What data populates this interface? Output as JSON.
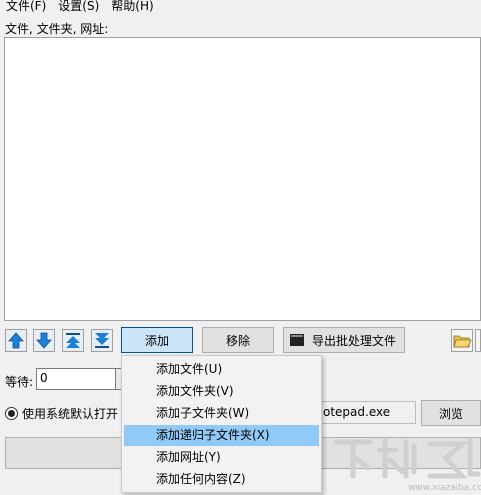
{
  "menubar": {
    "items": [
      "文件(F)",
      "设置(S)",
      "帮助(H)"
    ]
  },
  "list_label": "文件, 文件夹, 网址:",
  "toolbar": {
    "move_up_icon": "arrow-up",
    "move_down_icon": "arrow-down",
    "move_top_icon": "arrow-to-top",
    "move_bottom_icon": "arrow-to-bottom",
    "add_label": "添加",
    "remove_label": "移除",
    "export_label": "导出批处理文件",
    "open_folder_icon": "folder-open"
  },
  "wait": {
    "label": "等待:",
    "value": "0"
  },
  "open_with": {
    "label": "使用系统默认打开",
    "path_value": "otepad.exe",
    "browse_label": "浏览"
  },
  "add_menu": {
    "items": [
      "添加文件(U)",
      "添加文件夹(V)",
      "添加子文件夹(W)",
      "添加递归子文件夹(X)",
      "添加网址(Y)",
      "添加任何内容(Z)"
    ],
    "highlighted_index": 3
  },
  "watermark": {
    "domain": "www.xiazaiba.com"
  },
  "colors": {
    "arrow_blue": "#1e7fd8",
    "highlight": "#91c9f7"
  }
}
